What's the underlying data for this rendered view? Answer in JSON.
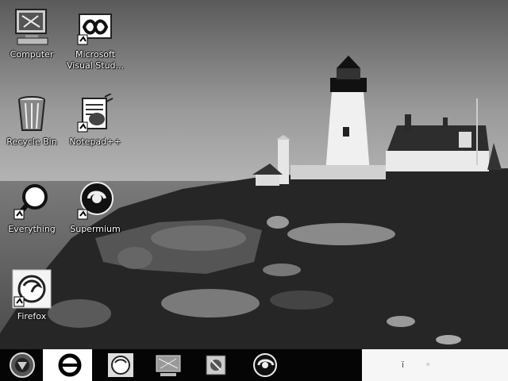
{
  "desktop": {
    "icons": [
      {
        "label": "Computer",
        "icon": "computer-icon"
      },
      {
        "label": "Microsoft Visual Stud...",
        "icon": "visual-studio-icon"
      },
      {
        "label": "Recycle Bin",
        "icon": "recycle-bin-icon"
      },
      {
        "label": "Notepad++",
        "icon": "notepad-plus-plus-icon"
      },
      {
        "label": "Everything",
        "icon": "everything-search-icon"
      },
      {
        "label": "Supermium",
        "icon": "supermium-icon"
      },
      {
        "label": "Firefox",
        "icon": "firefox-icon"
      }
    ]
  },
  "taskbar": {
    "buttons": [
      {
        "icon": "start-orb-icon"
      },
      {
        "icon": "internet-explorer-icon"
      },
      {
        "icon": "firefox-icon"
      },
      {
        "icon": "computer-icon"
      },
      {
        "icon": "file-manager-icon"
      },
      {
        "icon": "supermium-icon"
      }
    ],
    "tray": {
      "icons": [
        "network-icon",
        "volume-icon"
      ]
    }
  },
  "colors": {
    "taskbar": "#050505",
    "tray": "#f6f6f6"
  }
}
